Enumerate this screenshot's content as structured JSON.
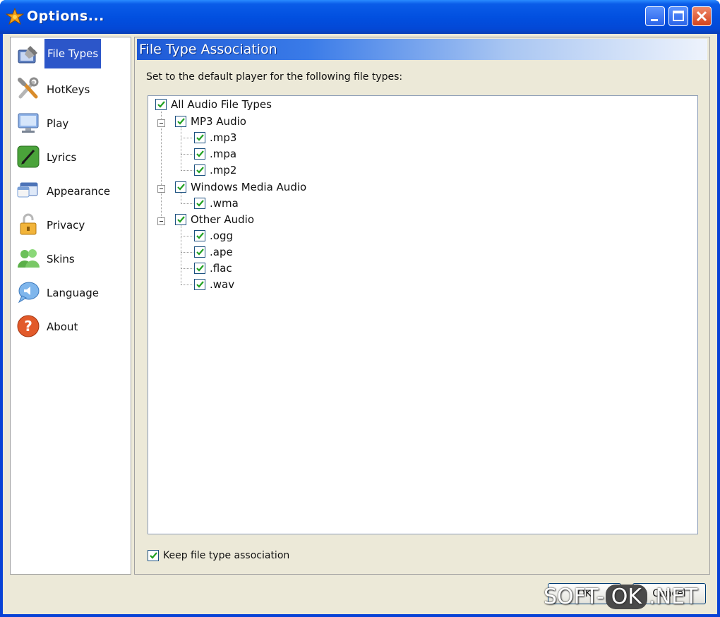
{
  "window": {
    "title": "Options..."
  },
  "sidebar": {
    "items": [
      {
        "label": "File Types",
        "icon": "pencil-icon",
        "selected": true
      },
      {
        "label": "HotKeys",
        "icon": "tools-icon",
        "selected": false
      },
      {
        "label": "Play",
        "icon": "monitor-icon",
        "selected": false
      },
      {
        "label": "Lyrics",
        "icon": "lyrics-pen-icon",
        "selected": false
      },
      {
        "label": "Appearance",
        "icon": "appearance-window-icon",
        "selected": false
      },
      {
        "label": "Privacy",
        "icon": "lock-icon",
        "selected": false
      },
      {
        "label": "Skins",
        "icon": "users-icon",
        "selected": false
      },
      {
        "label": "Language",
        "icon": "speech-icon",
        "selected": false
      },
      {
        "label": "About",
        "icon": "help-icon",
        "selected": false
      }
    ]
  },
  "main": {
    "header": "File Type Association",
    "description": "Set to the default player for the following file types:",
    "tree": {
      "root": {
        "label": "All Audio File Types",
        "checked": true
      },
      "groups": [
        {
          "label": "MP3 Audio",
          "checked": true,
          "items": [
            ".mp3",
            ".mpa",
            ".mp2"
          ]
        },
        {
          "label": "Windows Media Audio",
          "checked": true,
          "items": [
            ".wma"
          ]
        },
        {
          "label": "Other Audio",
          "checked": true,
          "items": [
            ".ogg",
            ".ape",
            ".flac",
            ".wav"
          ]
        }
      ]
    },
    "keep_association": {
      "label": "Keep file type association",
      "checked": true
    }
  },
  "footer": {
    "ok_label": "OK",
    "cancel_label": "Cancel"
  },
  "watermark": {
    "left": "SOFT-",
    "middle": "OK",
    "right": ".NET"
  },
  "colors": {
    "titlebar": "#0a5ce8",
    "selection": "#2c56c9",
    "check": "#21a121",
    "panel": "#ece9d8"
  }
}
